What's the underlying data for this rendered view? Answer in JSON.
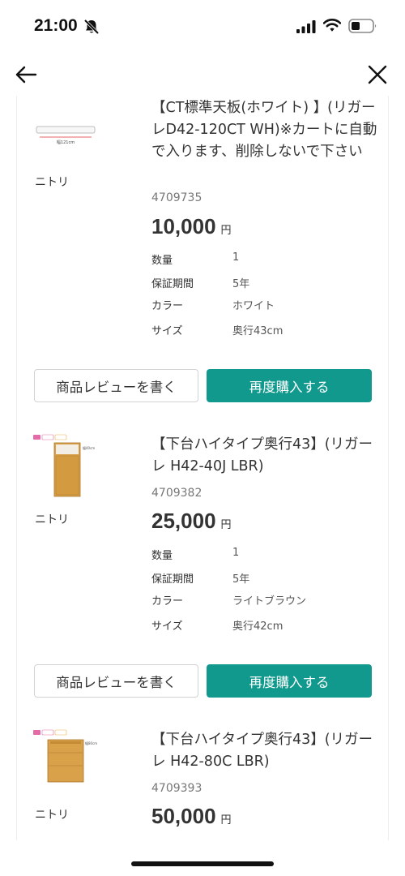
{
  "status_bar": {
    "time": "21:00"
  },
  "buttons": {
    "review": "商品レビューを書く",
    "rebuy": "再度購入する"
  },
  "spec_labels": {
    "qty": "数量",
    "warranty": "保証期間",
    "color": "カラー",
    "size": "サイズ"
  },
  "items": [
    {
      "brand": "ニトリ",
      "title": "【CT標準天板(ホワイト) 】(リガーレD42-120CT WH)※カートに自動で入ります、削除しないで下さい",
      "code": "4709735",
      "price": "10,000",
      "currency": "円",
      "qty": "1",
      "warranty": "5年",
      "color": "ホワイト",
      "size": "奥行43cm",
      "thumb_text": "幅121cm"
    },
    {
      "brand": "ニトリ",
      "title": "【下台ハイタイプ奥行43】(リガーレ H42-40J LBR)",
      "code": "4709382",
      "price": "25,000",
      "currency": "円",
      "qty": "1",
      "warranty": "5年",
      "color": "ライトブラウン",
      "size": "奥行42cm",
      "thumb_text": "幅40cm"
    },
    {
      "brand": "ニトリ",
      "title": "【下台ハイタイプ奥行43】(リガーレ H42-80C LBR)",
      "code": "4709393",
      "price": "50,000",
      "currency": "円",
      "thumb_text": "幅80cm"
    }
  ]
}
